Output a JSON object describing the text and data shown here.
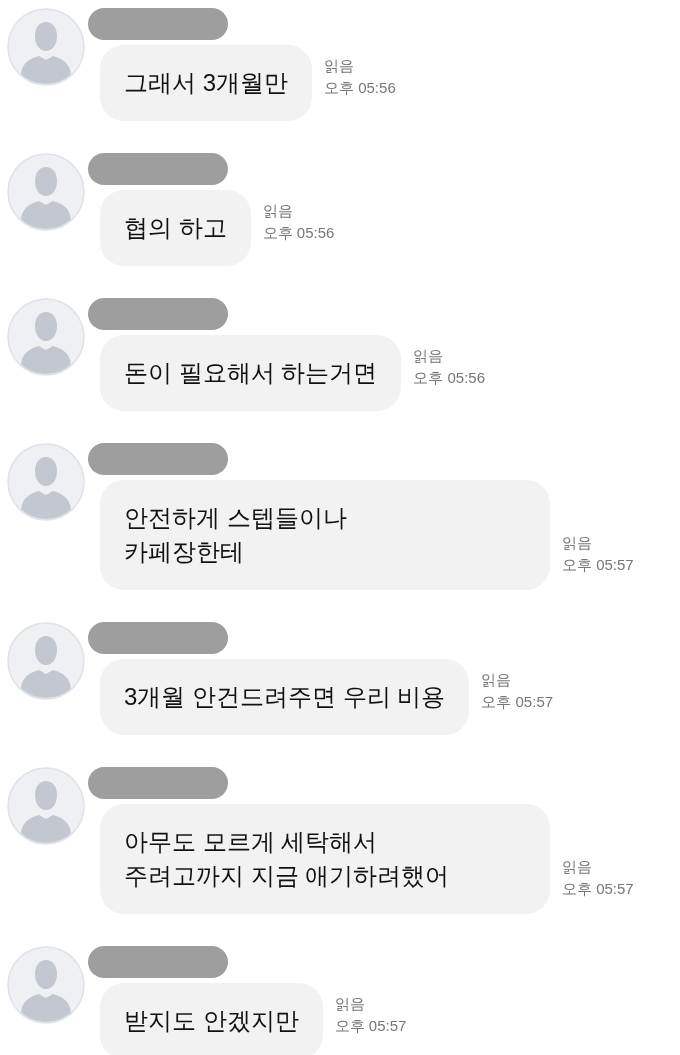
{
  "messages": [
    {
      "name_redacted": true,
      "lines": [
        "그래서 3개월만"
      ],
      "read_label": "읽음",
      "time": "오후 05:56"
    },
    {
      "name_redacted": true,
      "lines": [
        "협의 하고"
      ],
      "read_label": "읽음",
      "time": "오후 05:56"
    },
    {
      "name_redacted": true,
      "lines": [
        "돈이 필요해서 하는거면"
      ],
      "read_label": "읽음",
      "time": "오후 05:56"
    },
    {
      "name_redacted": true,
      "lines": [
        "안전하게 스텝들이나",
        "카페장한테"
      ],
      "read_label": "읽음",
      "time": "오후 05:57"
    },
    {
      "name_redacted": true,
      "lines": [
        "3개월 안건드려주면 우리 비용"
      ],
      "read_label": "읽음",
      "time": "오후 05:57"
    },
    {
      "name_redacted": true,
      "lines": [
        "아무도 모르게 세탁해서",
        "주려고까지 지금 애기하려했어"
      ],
      "read_label": "읽음",
      "time": "오후 05:57"
    },
    {
      "name_redacted": true,
      "lines": [
        "받지도 안겠지만"
      ],
      "read_label": "읽음",
      "time": "오후 05:57"
    }
  ]
}
